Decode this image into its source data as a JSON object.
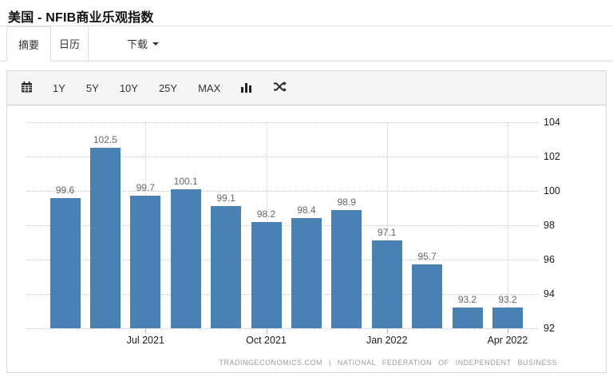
{
  "header": {
    "title": "美国 - NFIB商业乐观指数"
  },
  "tabs": [
    {
      "label": "摘要",
      "active": true
    },
    {
      "label": "日历",
      "active": false
    },
    {
      "label": "下载",
      "active": false,
      "has_dropdown": true
    }
  ],
  "toolbar": {
    "ranges": [
      "1Y",
      "5Y",
      "10Y",
      "25Y",
      "MAX"
    ],
    "icons": [
      "calendar-icon",
      "column-chart-icon",
      "shuffle-icon"
    ]
  },
  "chart_data": {
    "type": "bar",
    "title": "",
    "values": [
      99.6,
      102.5,
      99.7,
      100.1,
      99.1,
      98.2,
      98.4,
      98.9,
      97.1,
      95.7,
      93.2,
      93.2
    ],
    "data_labels": [
      "99.6",
      "102.5",
      "99.7",
      "100.1",
      "99.1",
      "98.2",
      "98.4",
      "98.9",
      "97.1",
      "95.7",
      "93.2",
      "93.2"
    ],
    "x_ticks": [
      {
        "index": 2,
        "label": "Jul 2021"
      },
      {
        "index": 5,
        "label": "Oct 2021"
      },
      {
        "index": 8,
        "label": "Jan 2022"
      },
      {
        "index": 11,
        "label": "Apr 2022"
      }
    ],
    "y_ticks": [
      104,
      102,
      100,
      98,
      96,
      94,
      92
    ],
    "ylim": [
      92,
      104
    ],
    "y_axis_position": "right",
    "grid": "dotted",
    "bar_color": "#4a81b4",
    "data_label_color": "#666666",
    "source_line": "TRADINGECONOMICS.COM | NATIONAL FEDERATION OF INDEPENDENT BUSINESS"
  }
}
